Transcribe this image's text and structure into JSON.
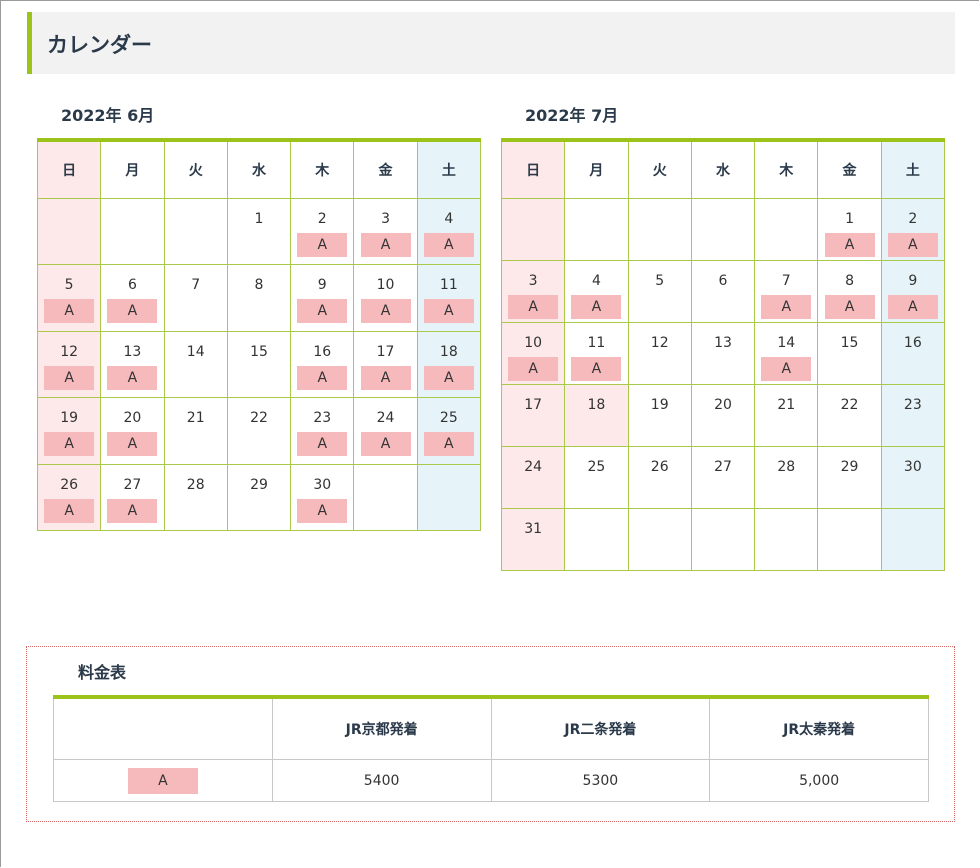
{
  "section": {
    "title": "カレンダー"
  },
  "weekdays": [
    "日",
    "月",
    "火",
    "水",
    "木",
    "金",
    "土"
  ],
  "calendars": [
    {
      "title": "2022年 6月",
      "weeks": [
        [
          {
            "day": "",
            "mark": ""
          },
          {
            "day": "",
            "mark": ""
          },
          {
            "day": "",
            "mark": ""
          },
          {
            "day": "1",
            "mark": ""
          },
          {
            "day": "2",
            "mark": "A"
          },
          {
            "day": "3",
            "mark": "A"
          },
          {
            "day": "4",
            "mark": "A"
          }
        ],
        [
          {
            "day": "5",
            "mark": "A"
          },
          {
            "day": "6",
            "mark": "A"
          },
          {
            "day": "7",
            "mark": ""
          },
          {
            "day": "8",
            "mark": ""
          },
          {
            "day": "9",
            "mark": "A"
          },
          {
            "day": "10",
            "mark": "A"
          },
          {
            "day": "11",
            "mark": "A"
          }
        ],
        [
          {
            "day": "12",
            "mark": "A"
          },
          {
            "day": "13",
            "mark": "A"
          },
          {
            "day": "14",
            "mark": ""
          },
          {
            "day": "15",
            "mark": ""
          },
          {
            "day": "16",
            "mark": "A"
          },
          {
            "day": "17",
            "mark": "A"
          },
          {
            "day": "18",
            "mark": "A"
          }
        ],
        [
          {
            "day": "19",
            "mark": "A"
          },
          {
            "day": "20",
            "mark": "A"
          },
          {
            "day": "21",
            "mark": ""
          },
          {
            "day": "22",
            "mark": ""
          },
          {
            "day": "23",
            "mark": "A"
          },
          {
            "day": "24",
            "mark": "A"
          },
          {
            "day": "25",
            "mark": "A"
          }
        ],
        [
          {
            "day": "26",
            "mark": "A"
          },
          {
            "day": "27",
            "mark": "A"
          },
          {
            "day": "28",
            "mark": ""
          },
          {
            "day": "29",
            "mark": ""
          },
          {
            "day": "30",
            "mark": "A"
          },
          {
            "day": "",
            "mark": ""
          },
          {
            "day": "",
            "mark": ""
          }
        ]
      ]
    },
    {
      "title": "2022年 7月",
      "weeks": [
        [
          {
            "day": "",
            "mark": ""
          },
          {
            "day": "",
            "mark": ""
          },
          {
            "day": "",
            "mark": ""
          },
          {
            "day": "",
            "mark": ""
          },
          {
            "day": "",
            "mark": ""
          },
          {
            "day": "1",
            "mark": "A"
          },
          {
            "day": "2",
            "mark": "A"
          }
        ],
        [
          {
            "day": "3",
            "mark": "A"
          },
          {
            "day": "4",
            "mark": "A"
          },
          {
            "day": "5",
            "mark": ""
          },
          {
            "day": "6",
            "mark": ""
          },
          {
            "day": "7",
            "mark": "A"
          },
          {
            "day": "8",
            "mark": "A"
          },
          {
            "day": "9",
            "mark": "A"
          }
        ],
        [
          {
            "day": "10",
            "mark": "A"
          },
          {
            "day": "11",
            "mark": "A"
          },
          {
            "day": "12",
            "mark": ""
          },
          {
            "day": "13",
            "mark": ""
          },
          {
            "day": "14",
            "mark": "A"
          },
          {
            "day": "15",
            "mark": ""
          },
          {
            "day": "16",
            "mark": ""
          }
        ],
        [
          {
            "day": "17",
            "mark": ""
          },
          {
            "day": "18",
            "mark": "",
            "holiday": true
          },
          {
            "day": "19",
            "mark": ""
          },
          {
            "day": "20",
            "mark": ""
          },
          {
            "day": "21",
            "mark": ""
          },
          {
            "day": "22",
            "mark": ""
          },
          {
            "day": "23",
            "mark": ""
          }
        ],
        [
          {
            "day": "24",
            "mark": ""
          },
          {
            "day": "25",
            "mark": ""
          },
          {
            "day": "26",
            "mark": ""
          },
          {
            "day": "27",
            "mark": ""
          },
          {
            "day": "28",
            "mark": ""
          },
          {
            "day": "29",
            "mark": ""
          },
          {
            "day": "30",
            "mark": ""
          }
        ],
        [
          {
            "day": "31",
            "mark": ""
          },
          {
            "day": "",
            "mark": ""
          },
          {
            "day": "",
            "mark": ""
          },
          {
            "day": "",
            "mark": ""
          },
          {
            "day": "",
            "mark": ""
          },
          {
            "day": "",
            "mark": ""
          },
          {
            "day": "",
            "mark": ""
          }
        ]
      ]
    }
  ],
  "price_table": {
    "title": "料金表",
    "headers": [
      "",
      "JR京都発着",
      "JR二条発着",
      "JR太秦発着"
    ],
    "rows": [
      {
        "label": "A",
        "values": [
          "5400",
          "5300",
          "5,000"
        ]
      }
    ]
  },
  "colors": {
    "accent": "#9bc31a",
    "badge": "#f6babd",
    "sunday_bg": "#fde9ea",
    "saturday_bg": "#e6f4f9"
  }
}
